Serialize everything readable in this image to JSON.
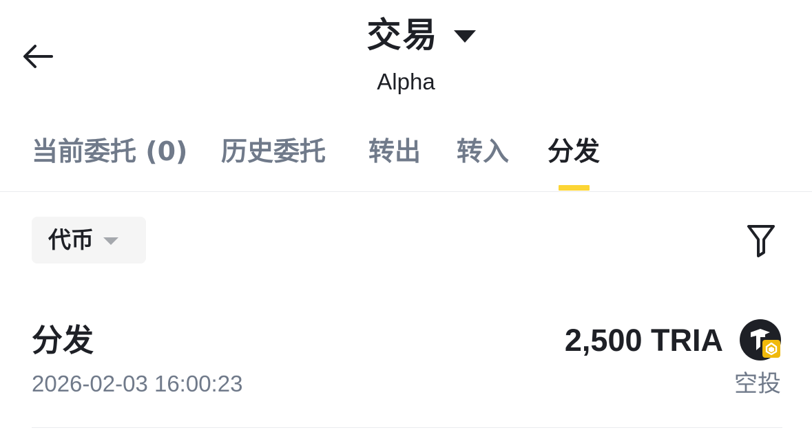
{
  "header": {
    "title": "交易",
    "subtitle": "Alpha"
  },
  "tabs": [
    {
      "label": "当前委托 (0)",
      "active": false
    },
    {
      "label": "历史委托",
      "active": false
    },
    {
      "label": "转出",
      "active": false
    },
    {
      "label": "转入",
      "active": false
    },
    {
      "label": "分发",
      "active": true
    }
  ],
  "filters": {
    "token_label": "代币"
  },
  "records": [
    {
      "type": "分发",
      "time": "2026-02-03 16:00:23",
      "amount": "2,500 TRIA",
      "status": "空投"
    }
  ],
  "colors": {
    "accent": "#fcd535",
    "text_primary": "#1e2026",
    "text_secondary": "#707a8a",
    "divider": "#eaecef",
    "chip_background": "#f5f5f5"
  },
  "icons": {
    "back": "back-arrow-icon",
    "title_dropdown": "caret-down-icon",
    "token_dropdown": "caret-down-icon",
    "filter": "filter-icon",
    "token_logo": "tria-token-logo",
    "chain_badge": "bnb-chain-badge-icon"
  }
}
